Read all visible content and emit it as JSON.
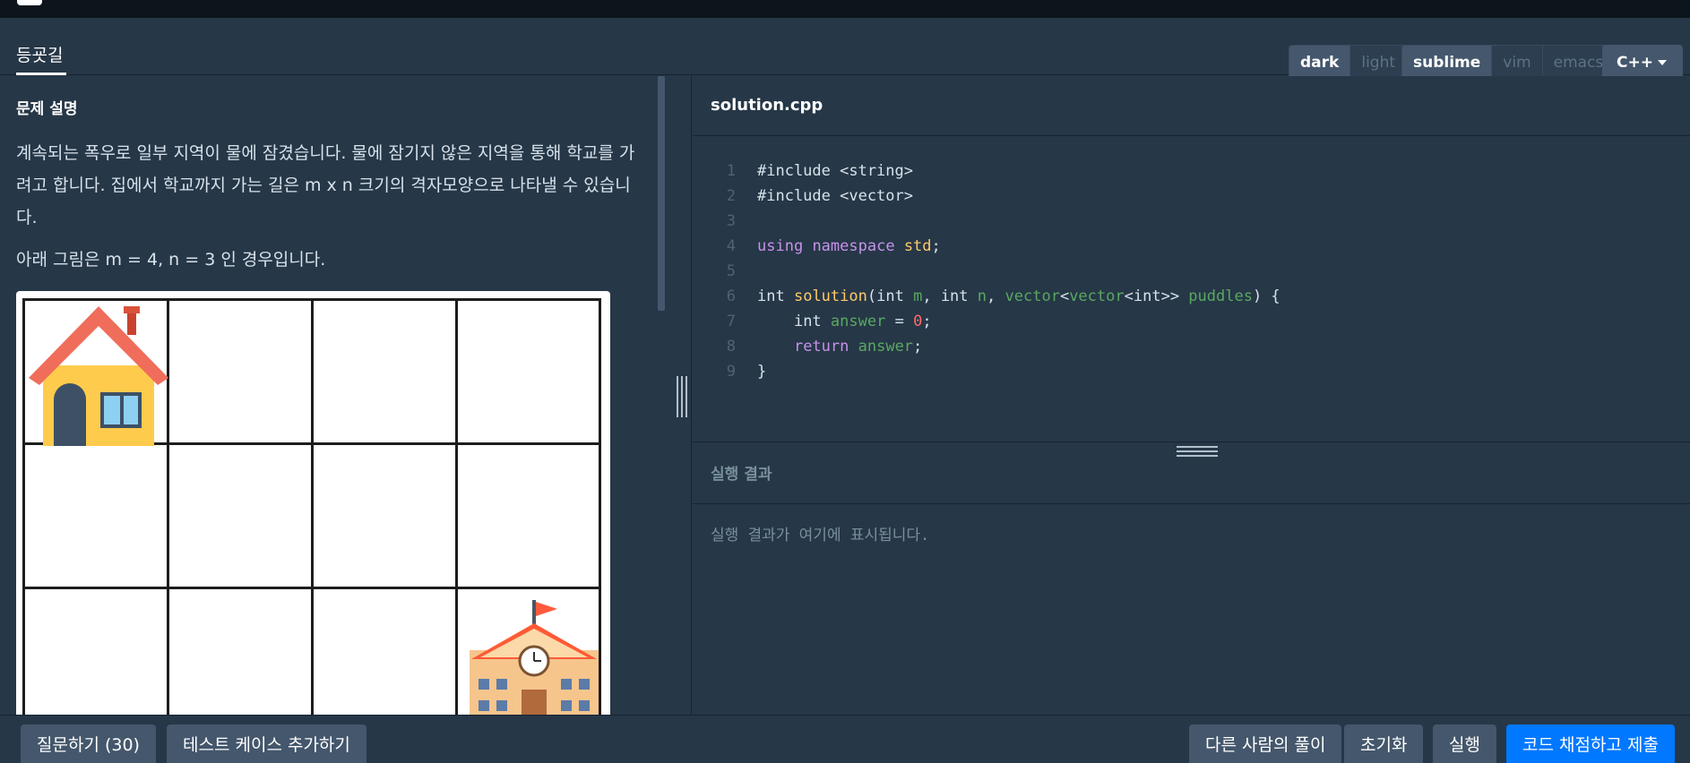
{
  "header": {
    "tab_title": "등굣길",
    "theme_options": [
      "dark",
      "light"
    ],
    "theme_selected": "dark",
    "editor_options": [
      "sublime",
      "vim",
      "emacs"
    ],
    "editor_selected": "sublime",
    "language": "C++"
  },
  "problem": {
    "section_title": "문제 설명",
    "description": "계속되는 폭우로 일부 지역이 물에 잠겼습니다. 물에 잠기지 않은 지역을 통해 학교를 가려고 합니다. 집에서 학교까지 가는 길은 m x n 크기의 격자모양으로 나타낼 수 있습니다.",
    "figure_caption": "아래 그림은 m = 4, n = 3 인 경우입니다."
  },
  "editor": {
    "file_name": "solution.cpp",
    "line_numbers": [
      "1",
      "2",
      "3",
      "4",
      "5",
      "6",
      "7",
      "8",
      "9"
    ]
  },
  "result": {
    "title": "실행 결과",
    "placeholder": "실행 결과가 여기에 표시됩니다."
  },
  "footer": {
    "ask_button": "질문하기 (30)",
    "add_testcase_button": "테스트 케이스 추가하기",
    "others_solutions_button": "다른 사람의 풀이",
    "reset_button": "초기화",
    "run_button": "실행",
    "submit_button": "코드 채점하고 제출"
  }
}
